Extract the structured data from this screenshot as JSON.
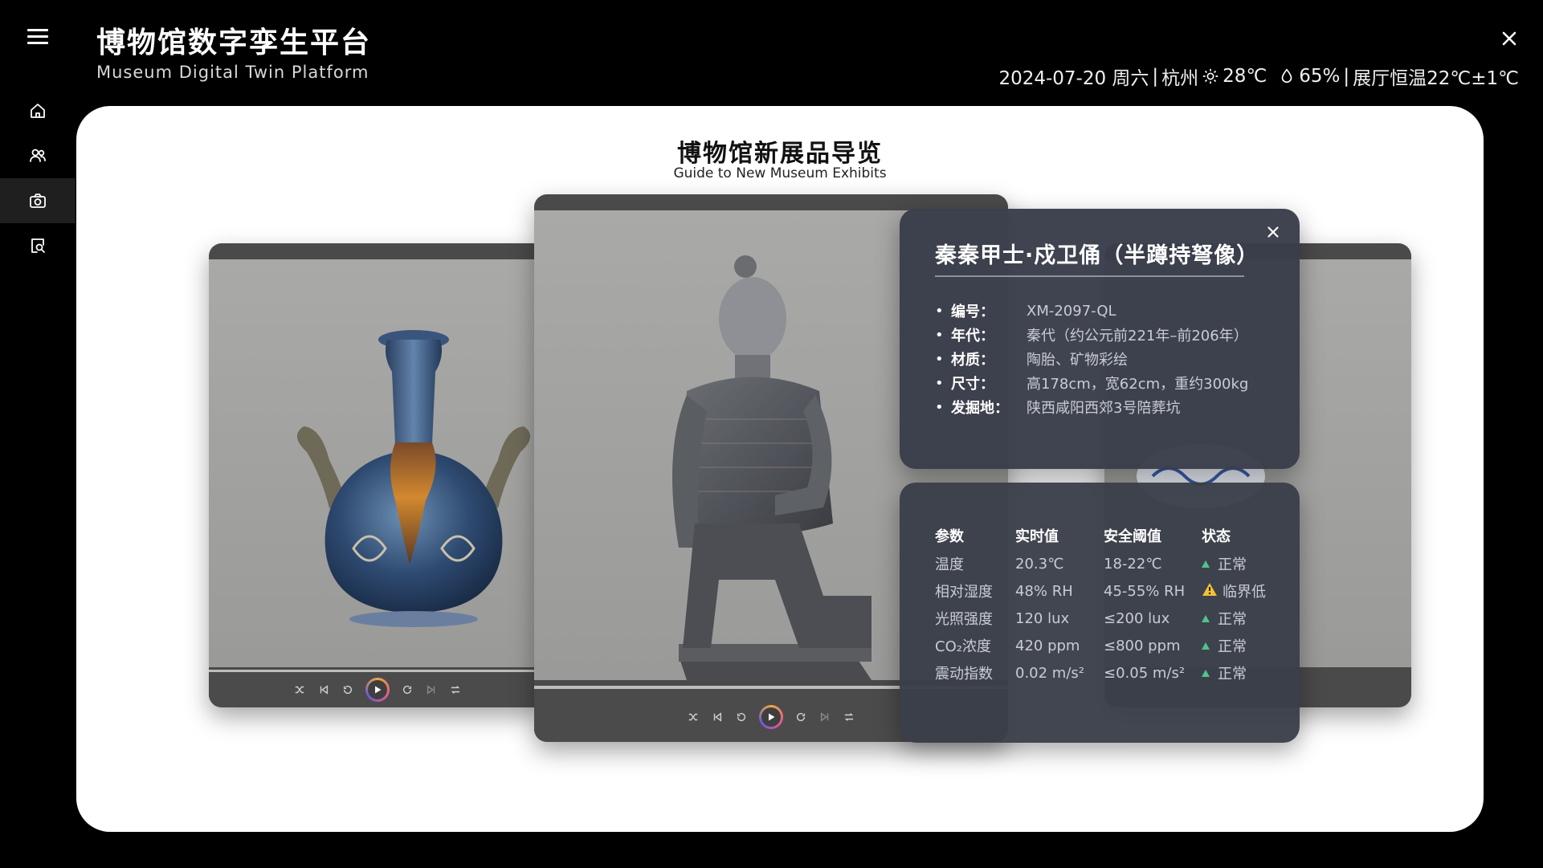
{
  "header": {
    "title": "博物馆数字孪生平台",
    "subtitle": "Museum Digital Twin Platform",
    "status": {
      "date": "2024-07-20 周六",
      "city": "杭州",
      "temperature": "28℃",
      "humidity": "65%",
      "hall_temp": "展厅恒温22℃±1℃",
      "separator": "|"
    }
  },
  "sidebar": {
    "items": [
      {
        "icon": "home-icon"
      },
      {
        "icon": "users-icon"
      },
      {
        "icon": "camera-icon",
        "active": true
      },
      {
        "icon": "search-doc-icon"
      }
    ]
  },
  "panel": {
    "title": "博物馆新展品导览",
    "subtitle": "Guide to New Museum Exhibits"
  },
  "exhibit": {
    "title": "秦秦甲士·戍卫俑（半蹲持弩像）",
    "fields": [
      {
        "label": "编号：",
        "value": "XM-2097-QL"
      },
      {
        "label": "年代：",
        "value": "秦代（约公元前221年–前206年）"
      },
      {
        "label": "材质：",
        "value": "陶胎、矿物彩绘"
      },
      {
        "label": "尺寸：",
        "value": "高178cm，宽62cm，重约300kg"
      },
      {
        "label": "发掘地：",
        "value": "陕西咸阳西郊3号陪葬坑"
      }
    ]
  },
  "environment": {
    "headers": [
      "参数",
      "实时值",
      "安全阈值",
      "状态"
    ],
    "rows": [
      {
        "param": "温度",
        "value": "20.3℃",
        "threshold": "18-22℃",
        "status": "正常",
        "level": "ok"
      },
      {
        "param": "相对湿度",
        "value": "48% RH",
        "threshold": "45-55% RH",
        "status": "临界低",
        "level": "warn"
      },
      {
        "param": "光照强度",
        "value": "120 lux",
        "threshold": "≤200 lux",
        "status": "正常",
        "level": "ok"
      },
      {
        "param": "CO₂浓度",
        "value": "420 ppm",
        "threshold": "≤800 ppm",
        "status": "正常",
        "level": "ok"
      },
      {
        "param": "震动指数",
        "value": "0.02 m/s²",
        "threshold": "≤0.05 m/s²",
        "status": "正常",
        "level": "ok"
      }
    ]
  },
  "colors": {
    "ok": "#4ec48a",
    "warn": "#f2c230",
    "panel_bg": "#ffffff",
    "overlay_bg": "#3a3e4a"
  }
}
